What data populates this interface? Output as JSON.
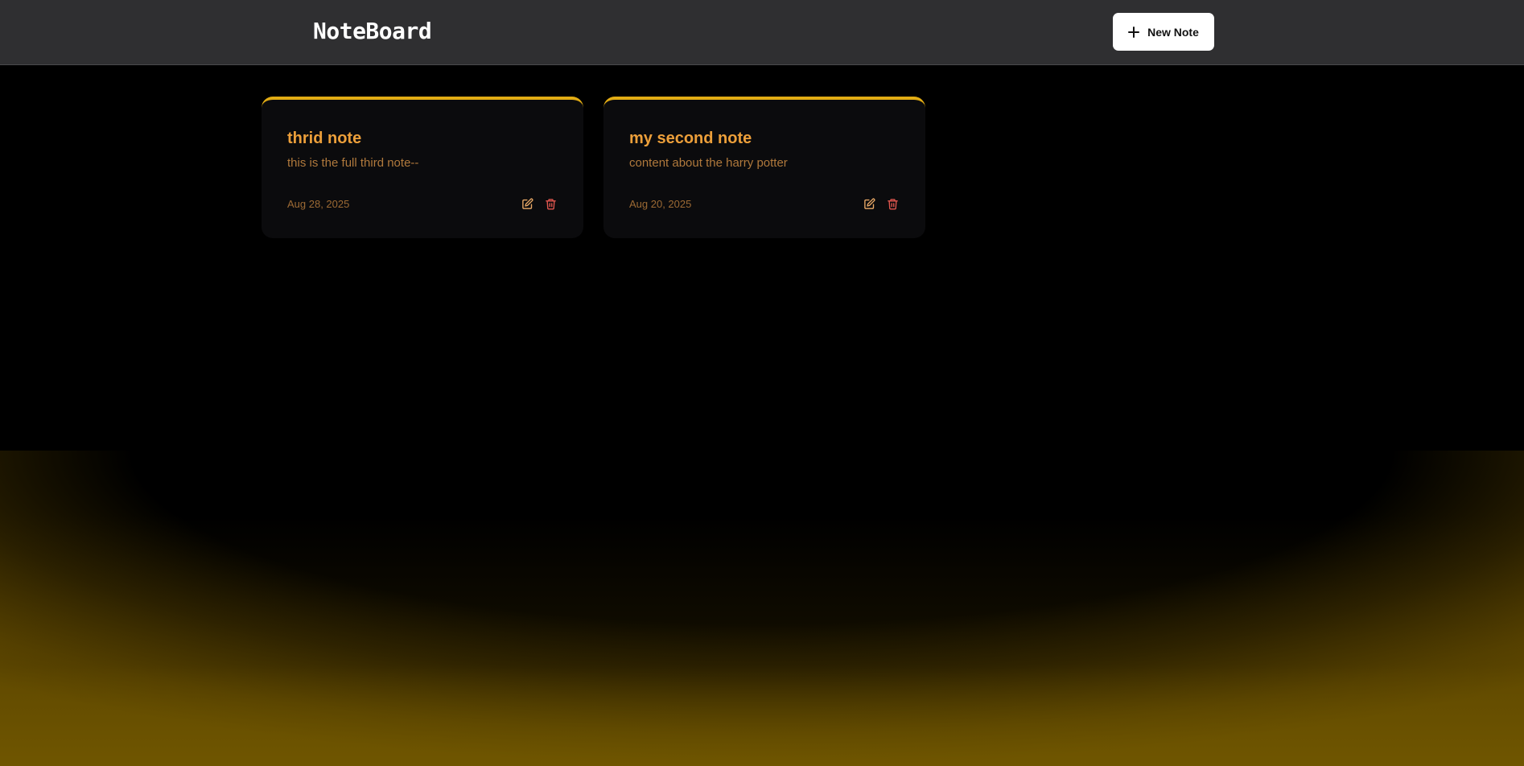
{
  "app": {
    "title": "NoteBoard"
  },
  "header": {
    "new_note_label": "New Note",
    "new_note_icon": "plus-icon"
  },
  "notes": [
    {
      "title": "thrid note",
      "content": "this is the full third note--",
      "date": "Aug 28, 2025",
      "edit_icon": "edit-icon",
      "delete_icon": "trash-icon"
    },
    {
      "title": "my second note",
      "content": "content about the harry potter",
      "date": "Aug 20, 2025",
      "edit_icon": "edit-icon",
      "delete_icon": "trash-icon"
    }
  ],
  "colors": {
    "accent": "#e2ac14",
    "title_text": "#ec9f3a",
    "body_text": "#b0793c",
    "date_text": "#9c6a34",
    "delete_icon": "#e0564e",
    "edit_icon": "#e8a866",
    "navbar_bg": "#2f2f31",
    "card_bg": "#0b0b0d"
  }
}
